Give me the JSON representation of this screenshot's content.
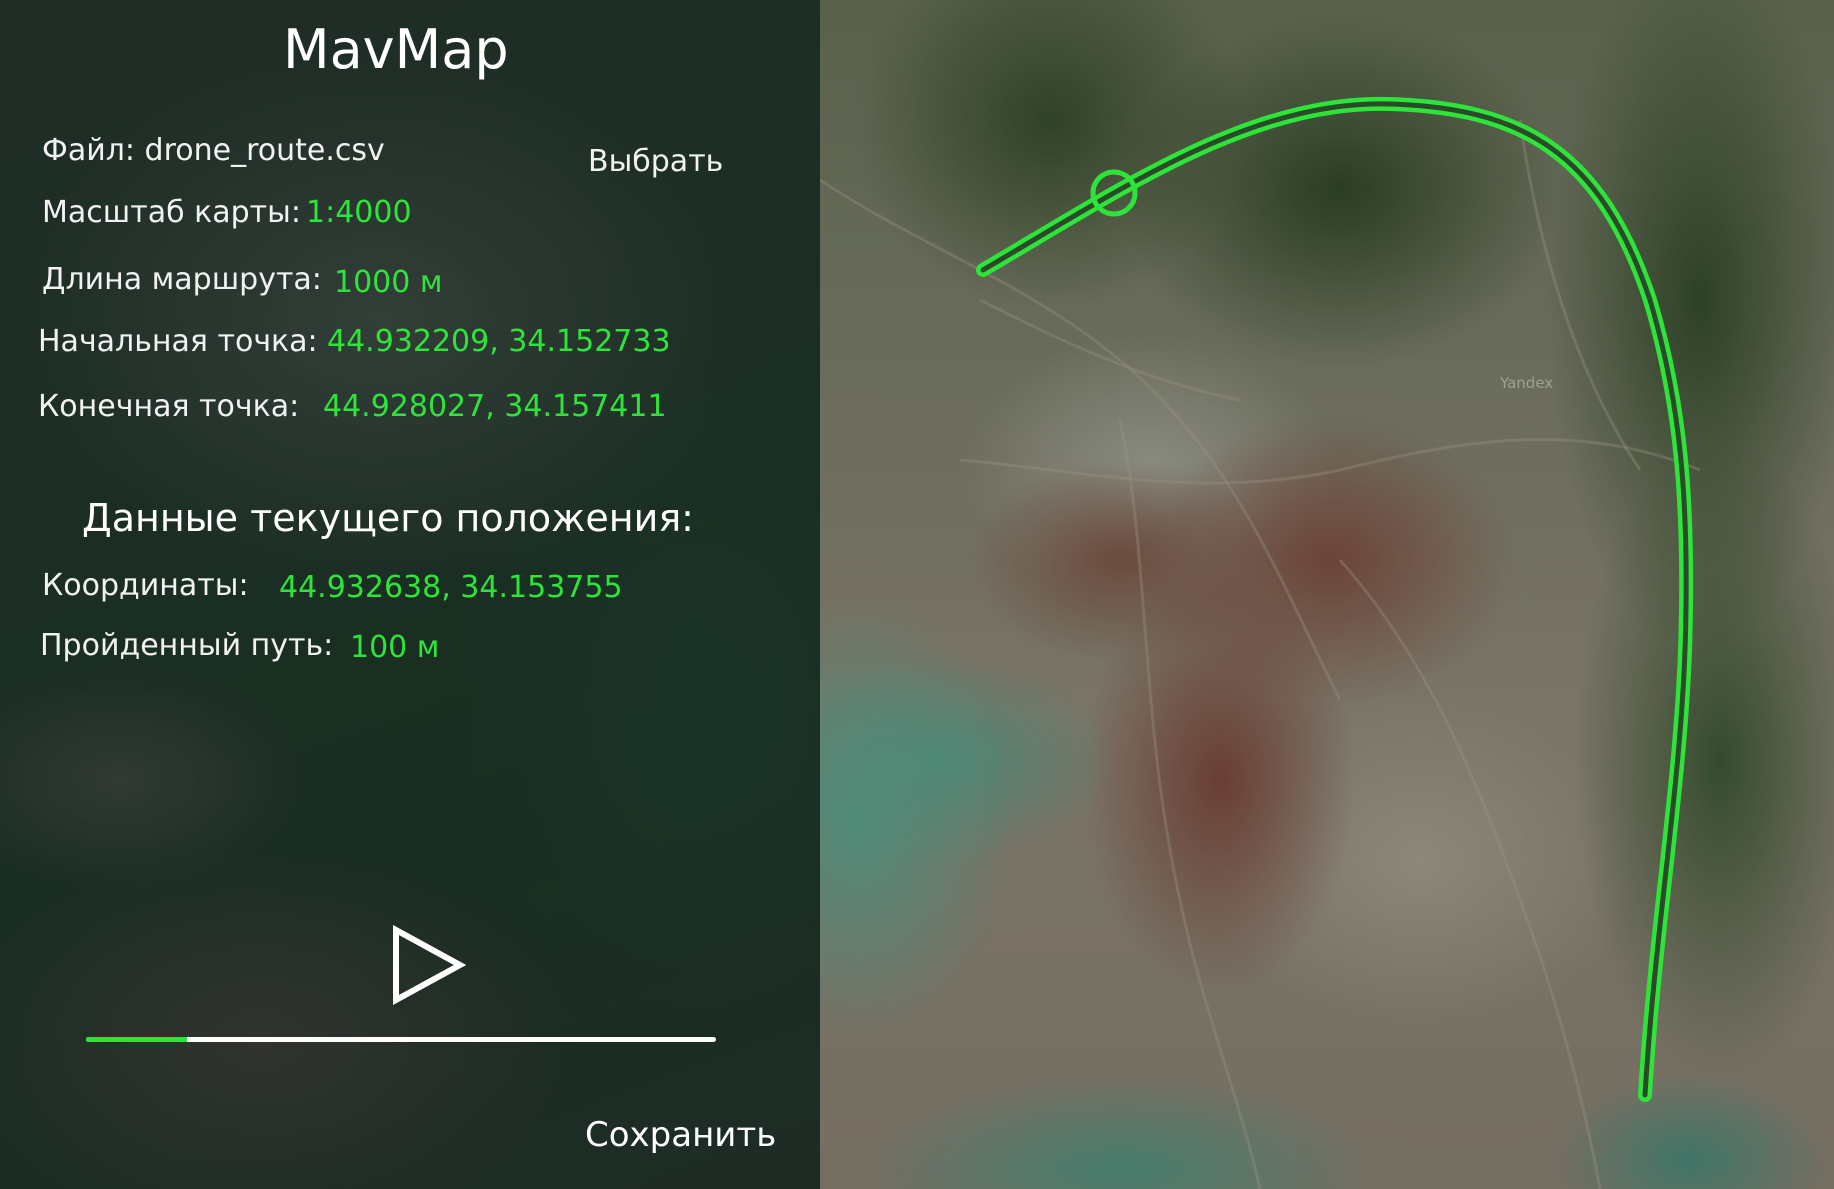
{
  "app": {
    "title": "MavMap"
  },
  "file": {
    "label": "Файл: drone_route.csv",
    "choose_label": "Выбрать"
  },
  "route_info": {
    "scale_label": "Масштаб карты:",
    "scale_value": "1:4000",
    "length_label": "Длина маршрута:",
    "length_value": "1000 м",
    "start_label": "Начальная точка:",
    "start_value": "44.932209, 34.152733",
    "end_label": "Конечная точка:",
    "end_value": "44.928027, 34.157411"
  },
  "current_position": {
    "title": "Данные текущего положения:",
    "coords_label": "Координаты:",
    "coords_value": "44.932638, 34.153755",
    "traveled_label": "Пройденный путь:",
    "traveled_value": "100 м"
  },
  "playback": {
    "play_icon": "play-icon",
    "progress": 0.16
  },
  "actions": {
    "save_label": "Сохранить"
  },
  "map": {
    "watermarks": [
      "Yandex",
      "Yandex"
    ],
    "route_color": "#2ee43a",
    "route_inner_color": "#2a4a2a"
  },
  "colors": {
    "accent": "#2ee43a",
    "text": "#f2f2f2"
  }
}
